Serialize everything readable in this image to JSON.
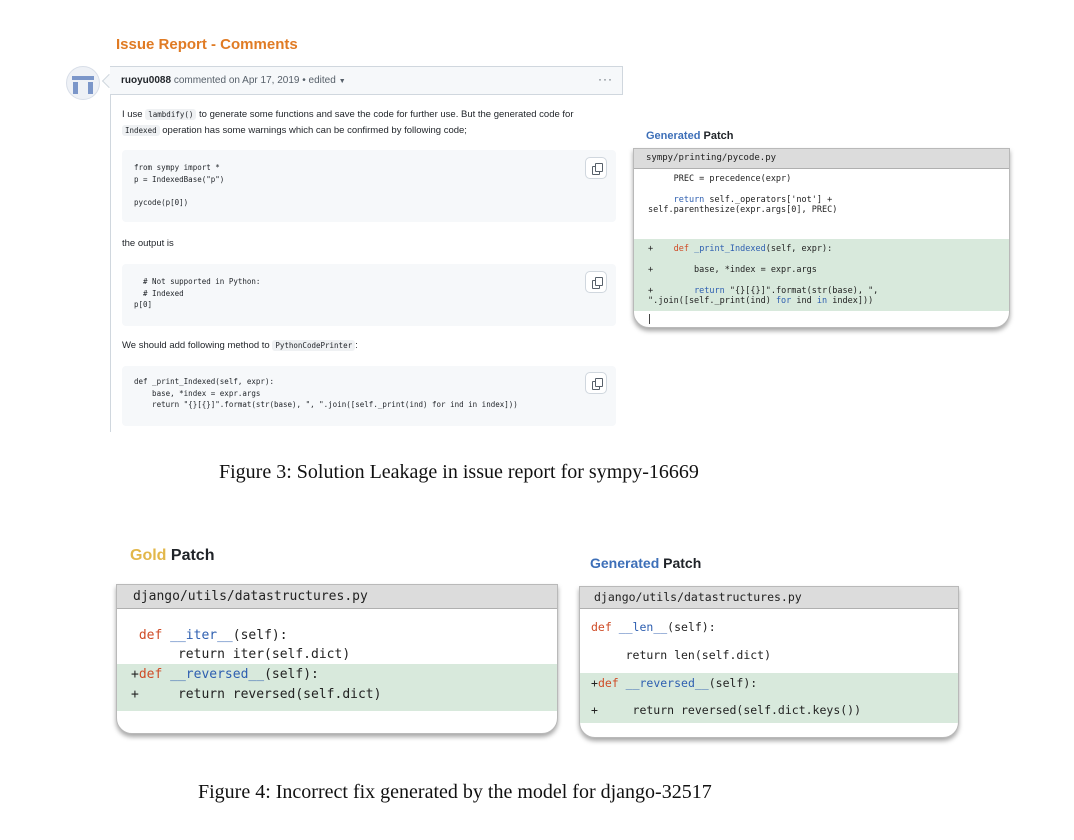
{
  "issue": {
    "section_title": "Issue Report - Comments",
    "username": "ruoyu0088",
    "commented_on": "commented on Apr 17, 2019",
    "edited": "• edited",
    "body_line1_pre": "I use",
    "inline_lambdify": "lambdify()",
    "body_line1_post": "to generate some functions and save the code for further use. But the generated code for",
    "inline_indexed": "Indexed",
    "body_line2_post": "operation has some warnings which can be confirmed by following code;",
    "code1": "from sympy import *\np = IndexedBase(\"p\")\n\npycode(p[0])",
    "output_is": "the output is",
    "code2": "  # Not supported in Python:\n  # Indexed\np[0]",
    "should_add_pre": "We should add following method to",
    "inline_printer": "PythonCodePrinter",
    "should_add_post": ":",
    "code3": "def _print_Indexed(self, expr):\n    base, *index = expr.args\n    return \"{}[{}]\".format(str(base), \", \".join([self._print(ind) for ind in index]))"
  },
  "fig3_patch": {
    "label_generated": "Generated",
    "label_patch": "Patch",
    "file": "sympy/printing/pycode.py",
    "l1": "     PREC = precedence(expr)",
    "l2_a": "     ",
    "l2_kw": "return",
    "l2_b": " self._operators['not'] +",
    "l3": "self.parenthesize(expr.args[0], PREC)",
    "l4_a": "+    ",
    "l4_kw": "def",
    "l4_fn": " _print_Indexed",
    "l4_b": "(self, expr):",
    "l5": "+        base, *index = expr.args",
    "l6_a": "+        ",
    "l6_kw": "return",
    "l6_b": " \"{}[{}]\".format(str(base), \",",
    "l7_a": "\".join([self._print(ind) ",
    "l7_for": "for",
    "l7_b": " ind ",
    "l7_in": "in",
    "l7_c": " index]))"
  },
  "fig3_caption": "Figure 3: Solution Leakage in issue report for sympy-16669",
  "gold_patch": {
    "label_gold": "Gold",
    "label_patch": "Patch",
    "file": "django/utils/datastructures.py",
    "l1_a": " ",
    "l1_kw": "def",
    "l1_fn": " __iter__",
    "l1_b": "(self):",
    "l2": "      return iter(self.dict)",
    "l3_a": "+",
    "l3_kw": "def",
    "l3_fn": " __reversed__",
    "l3_b": "(self):",
    "l4": "+     return reversed(self.dict)"
  },
  "fig4_generated": {
    "label_generated": "Generated",
    "label_patch": "Patch",
    "file": "django/utils/datastructures.py",
    "l1_kw": "def",
    "l1_fn": " __len__",
    "l1_b": "(self):",
    "l2": "     return len(self.dict)",
    "l3_a": "+",
    "l3_kw": "def",
    "l3_fn": " __reversed__",
    "l3_b": "(self):",
    "l4": "+     return reversed(self.dict.keys())"
  },
  "fig4_caption": "Figure 4: Incorrect fix generated by the model for django-32517"
}
